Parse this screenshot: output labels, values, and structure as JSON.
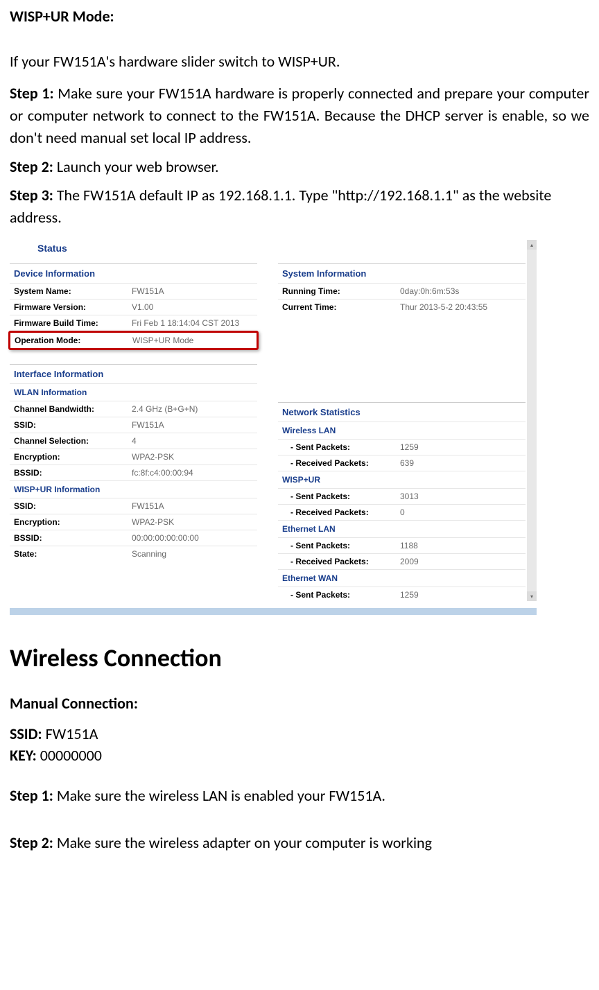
{
  "mode_heading": "WISP+UR Mode:",
  "intro": "If your FW151A's hardware slider switch to WISP+UR.",
  "step1_label": "Step 1:",
  "step1_text": " Make sure your FW151A hardware is properly connected and prepare your computer or computer network to connect to the FW151A. Because the DHCP server is enable, so we don't need manual set local IP address.",
  "step2_label": "Step 2:",
  "step2_text": " Launch your web browser.",
  "step3_label": "Step 3:",
  "step3_text": " The FW151A default IP as 192.168.1.1. Type \"http://192.168.1.1\" as the website address.",
  "screenshot": {
    "title": "Status",
    "device_info": {
      "header": "Device Information",
      "rows": [
        {
          "label": "System Name:",
          "value": "FW151A"
        },
        {
          "label": "Firmware Version:",
          "value": "V1.00"
        },
        {
          "label": "Firmware Build Time:",
          "value": "Fri Feb 1 18:14:04 CST 2013"
        },
        {
          "label": "Operation Mode:",
          "value": "WISP+UR Mode"
        }
      ]
    },
    "system_info": {
      "header": "System Information",
      "rows": [
        {
          "label": "Running Time:",
          "value": "0day:0h:6m:53s"
        },
        {
          "label": "Current Time:",
          "value": "Thur 2013-5-2 20:43:55"
        }
      ]
    },
    "interface_info": {
      "header": "Interface Information",
      "wlan_header": "WLAN Information",
      "wlan_rows": [
        {
          "label": "Channel Bandwidth:",
          "value": "2.4 GHz (B+G+N)"
        },
        {
          "label": "SSID:",
          "value": "FW151A"
        },
        {
          "label": "Channel Selection:",
          "value": "4"
        },
        {
          "label": "Encryption:",
          "value": "WPA2-PSK"
        },
        {
          "label": "BSSID:",
          "value": "fc:8f:c4:00:00:94"
        }
      ],
      "wisp_header": "WISP+UR Information",
      "wisp_rows": [
        {
          "label": "SSID:",
          "value": "FW151A"
        },
        {
          "label": "Encryption:",
          "value": "WPA2-PSK"
        },
        {
          "label": "BSSID:",
          "value": "00:00:00:00:00:00"
        },
        {
          "label": "State:",
          "value": "Scanning"
        }
      ]
    },
    "network_stats": {
      "header": "Network Statistics",
      "groups": [
        {
          "name": "Wireless LAN",
          "sent": "1259",
          "recv": "639"
        },
        {
          "name": "WISP+UR",
          "sent": "3013",
          "recv": "0"
        },
        {
          "name": "Ethernet LAN",
          "sent": "1188",
          "recv": "2009"
        },
        {
          "name": "Ethernet WAN",
          "sent": "1259"
        }
      ],
      "sent_label": "- Sent Packets:",
      "recv_label": "- Received Packets:"
    }
  },
  "wireless_heading": "Wireless Connection",
  "manual_heading": "Manual Connection:",
  "ssid_label": "SSID: ",
  "ssid_value": "FW151A",
  "key_label": "KEY: ",
  "key_value": "00000000",
  "wstep1_label": "Step 1:",
  "wstep1_text": " Make sure the wireless LAN is enabled your FW151A.",
  "wstep2_label": "Step 2:",
  "wstep2_text": " Make sure the wireless adapter on your computer is working"
}
